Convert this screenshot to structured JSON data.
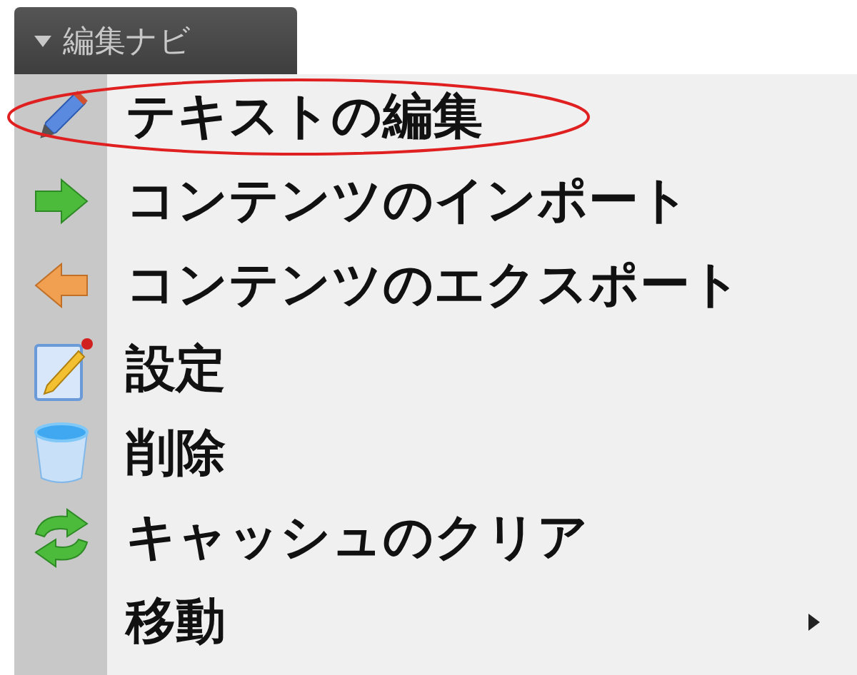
{
  "menu_button": {
    "label": "編集ナビ",
    "expanded": true
  },
  "items": [
    {
      "kind": "pencil",
      "label": "テキストの編集",
      "circled": true,
      "submenu": false
    },
    {
      "kind": "arrow-right",
      "label": "コンテンツのインポート",
      "circled": false,
      "submenu": false
    },
    {
      "kind": "arrow-left",
      "label": "コンテンツのエクスポート",
      "circled": false,
      "submenu": false
    },
    {
      "kind": "edit",
      "label": "設定",
      "circled": false,
      "submenu": false
    },
    {
      "kind": "bin",
      "label": "削除",
      "circled": false,
      "submenu": false
    },
    {
      "kind": "refresh",
      "label": "キャッシュのクリア",
      "circled": false,
      "submenu": false
    },
    {
      "kind": "none",
      "label": "移動",
      "circled": false,
      "submenu": true
    }
  ]
}
